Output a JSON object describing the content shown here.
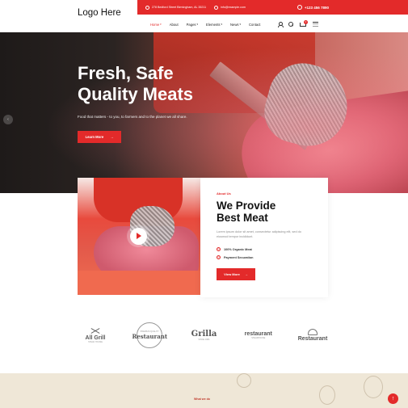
{
  "header": {
    "logo": "Logo Here",
    "address": "278 Bedford Street Birmingham, AL 35211",
    "email": "info@example.com",
    "phone": "+123 456 7890"
  },
  "nav": {
    "items": [
      {
        "label": "Home",
        "has_caret": true,
        "active": true
      },
      {
        "label": "About",
        "has_caret": false,
        "active": false
      },
      {
        "label": "Pages",
        "has_caret": true,
        "active": false
      },
      {
        "label": "Elements",
        "has_caret": true,
        "active": false
      },
      {
        "label": "News",
        "has_caret": true,
        "active": false
      },
      {
        "label": "Contact",
        "has_caret": false,
        "active": false
      }
    ],
    "cart_count": "0",
    "icons": [
      "user-icon",
      "search-icon",
      "cart-icon",
      "menu-icon"
    ]
  },
  "hero": {
    "title_line1": "Fresh, Safe",
    "title_line2": "Quality Meats",
    "subtitle": "Food that matters - to you, to farmers and to the planet we all share.",
    "button_label": "Learn More",
    "button_arrow": "→",
    "prev_arrow": "‹"
  },
  "about": {
    "eyebrow": "About Us",
    "title_line1": "We Provide",
    "title_line2": "Best Meat",
    "text": "Lorem ipsum dolor sit amet, consectetur adipiscing elit, sed do eiusmod tempor incididunt.",
    "features": [
      "100% Organic Meat",
      "Payment Securation"
    ],
    "button_label": "View More",
    "button_arrow": "→"
  },
  "brands": [
    {
      "name": "All Grill",
      "tag": "STEAK HOUSE"
    },
    {
      "name": "Restaurant",
      "tag": "PREMIUM QUALITY"
    },
    {
      "name": "Grilla",
      "tag": "SINCE 1984"
    },
    {
      "name": "restaurant",
      "tag": "STEAKHOUSE"
    },
    {
      "name": "Restaurant",
      "tag": ""
    }
  ],
  "bottom": {
    "eyebrow": "What we do",
    "to_top": "↑"
  },
  "colors": {
    "accent": "#e32a2a",
    "cream": "#efe7d7"
  }
}
